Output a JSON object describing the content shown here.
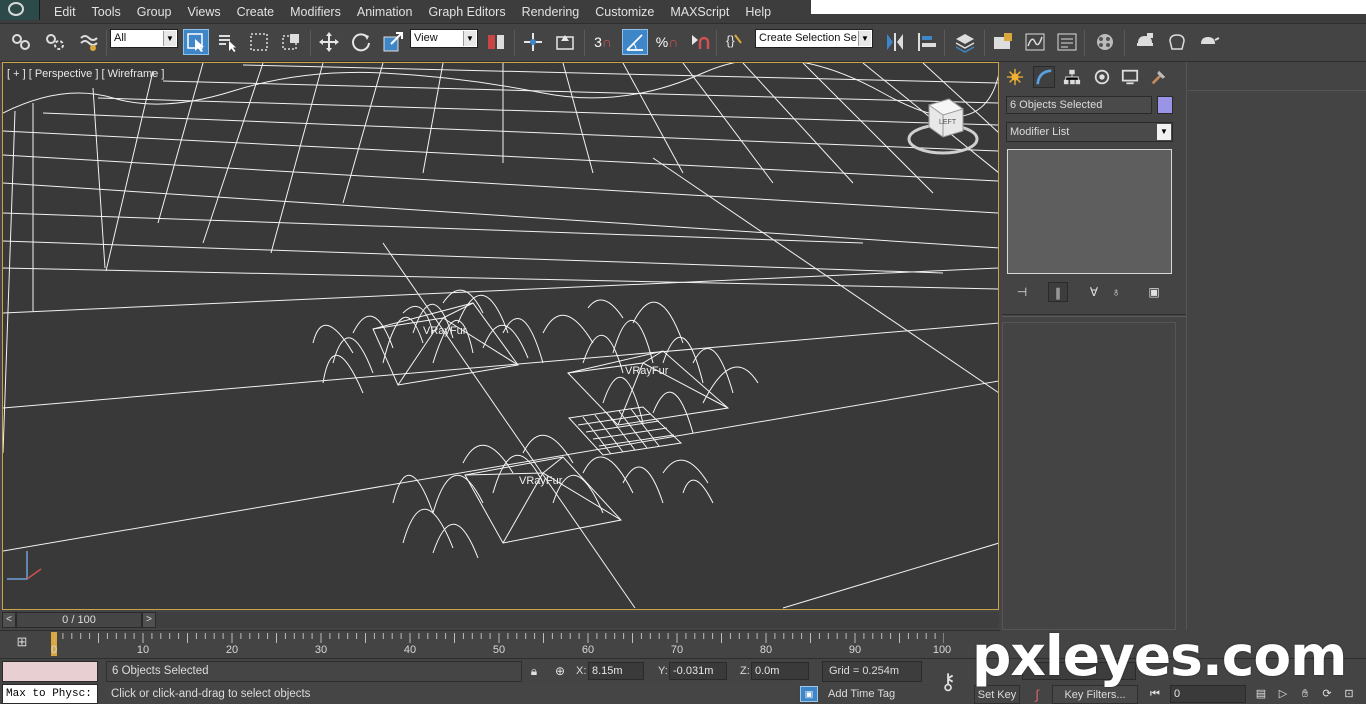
{
  "menu": {
    "items": [
      "Edit",
      "Tools",
      "Group",
      "Views",
      "Create",
      "Modifiers",
      "Animation",
      "Graph Editors",
      "Rendering",
      "Customize",
      "MAXScript",
      "Help"
    ]
  },
  "toolbar": {
    "selection_filter": "All",
    "reference_coord": "View",
    "named_selection_placeholder": "Create Selection Se",
    "snap_3d_label": "3",
    "angle_snap_label": "%"
  },
  "viewport": {
    "label": "[ + ] [ Perspective ] [ Wireframe ]",
    "objects": [
      "VRayFur",
      "VRayFur",
      "VRayFur"
    ],
    "viewcube_face": "LEFT",
    "border_color": "#c8a54a"
  },
  "command_panel": {
    "tabs": [
      "create-icon",
      "modify-icon",
      "hierarchy-icon",
      "motion-icon",
      "display-icon",
      "utilities-icon"
    ],
    "selection_name": "6 Objects Selected",
    "object_color": "#9a94e6",
    "modifier_list": "Modifier List"
  },
  "timeline": {
    "frame_display": "0 / 100",
    "prev": "<",
    "next": ">",
    "ticks": [
      "0",
      "10",
      "20",
      "30",
      "40",
      "50",
      "60",
      "70",
      "80",
      "90",
      "100"
    ]
  },
  "status": {
    "maxscript_input": "Max to Physc:",
    "selection_count": "6 Objects Selected",
    "prompt": "Click or click-and-drag to select objects",
    "x_label": "X:",
    "x_value": "8.15m",
    "y_label": "Y:",
    "y_value": "-0.031m",
    "z_label": "Z:",
    "z_value": "0.0m",
    "grid": "Grid = 0.254m",
    "add_time_tag": "Add Time Tag",
    "set_key": "Set Key",
    "key_filters": "Key Filters...",
    "current_frame": "0"
  },
  "watermark": "pxleyes.com",
  "colors": {
    "active_tool": "#3f86c8",
    "time_cursor": "#d9a73c",
    "viewport_bg": "#393939"
  }
}
